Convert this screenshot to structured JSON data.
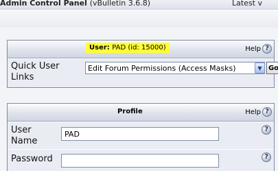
{
  "topbar": {
    "title": "Admin Control Panel",
    "version": "(vBulletin 3.6.8)",
    "latest": "Latest v"
  },
  "user_table": {
    "header_label": "User:",
    "header_user": "PAD (id: 15000)",
    "help_label": "Help",
    "quick_links_label": "Quick User Links",
    "quick_links_selected": "Edit Forum Permissions (Access Masks)",
    "go_label": "Go"
  },
  "profile_table": {
    "title": "Profile",
    "help_label": "Help",
    "username_label": "User Name",
    "username_value": "PAD",
    "password_label": "Password",
    "password_value": ""
  },
  "icons": {
    "help": "question-mark-icon",
    "dropdown": "chevron-down-icon"
  },
  "colors": {
    "highlight": "#ffff33",
    "border": "#7c8aa4"
  }
}
